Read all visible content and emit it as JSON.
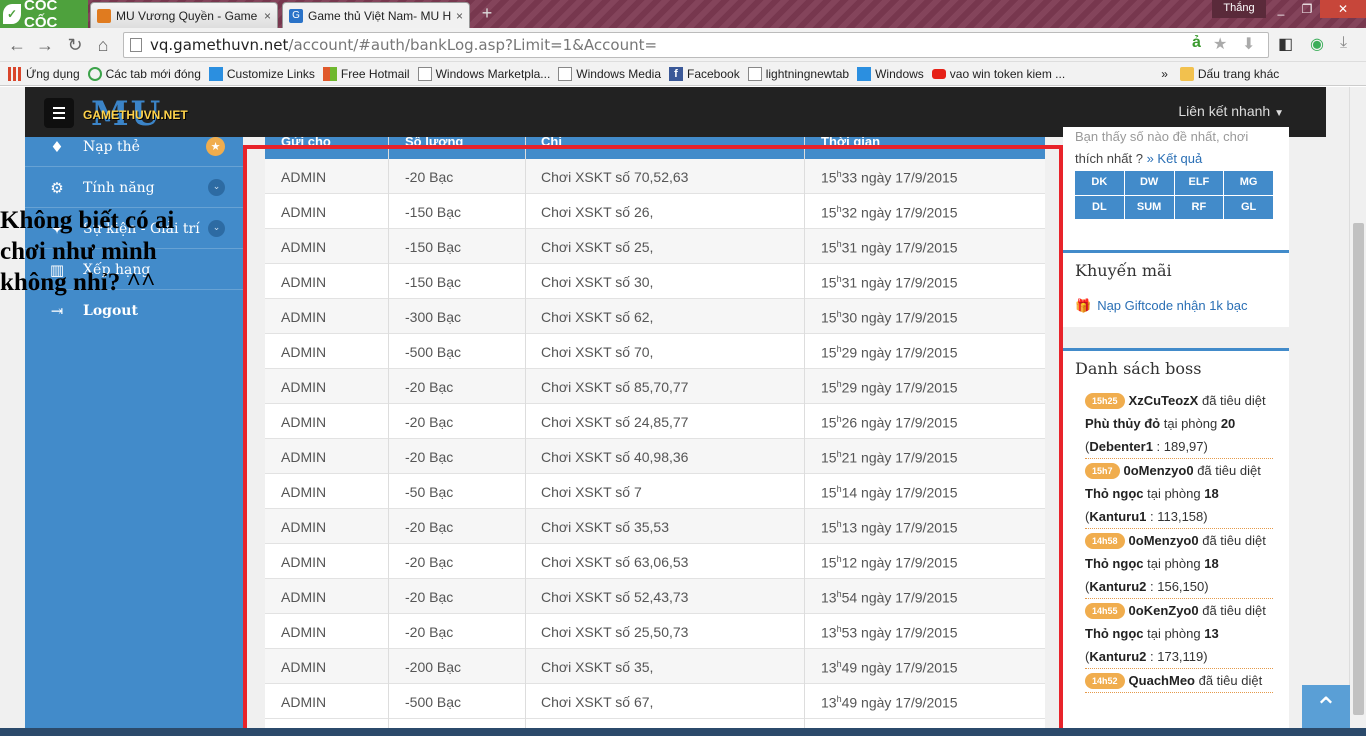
{
  "browser": {
    "brand": "CỐC CỐC",
    "tabs": [
      {
        "title": "MU Vương Quyền - Game",
        "close": "×"
      },
      {
        "title": "Game thủ Việt Nam- MU H",
        "close": "×"
      }
    ],
    "new_tab": "+",
    "user": "Thắng",
    "window_controls": [
      "_",
      "❐",
      "✕"
    ],
    "url_host": "vq.gamethuvn.net",
    "url_path": "/account/#auth/bankLog.asp?Limit=1&Account=",
    "bookmarks": [
      {
        "label": "Ứng dụng",
        "icon": "apps-grid-icon",
        "color": "#d9452b"
      },
      {
        "label": "Các tab mới đóng",
        "icon": "recent-tabs-icon",
        "color": "#3ca34a"
      },
      {
        "label": "Customize Links",
        "icon": "windows-logo-icon",
        "color": "#2b8fe0"
      },
      {
        "label": "Free Hotmail",
        "icon": "windows-flag-icon",
        "color": "#e0592b"
      },
      {
        "label": "Windows Marketpla...",
        "icon": "page-icon",
        "color": "#ffffff"
      },
      {
        "label": "Windows Media",
        "icon": "page-icon",
        "color": "#ffffff"
      },
      {
        "label": "Facebook",
        "icon": "facebook-icon",
        "color": "#3b5998"
      },
      {
        "label": "lightningnewtab",
        "icon": "page-icon",
        "color": "#ffffff"
      },
      {
        "label": "Windows",
        "icon": "windows-logo-icon",
        "color": "#2b8fe0"
      },
      {
        "label": "vao win token kiem ...",
        "icon": "youtube-icon",
        "color": "#e62117"
      }
    ],
    "bookmarks_overflow": "»",
    "other_bookmarks": "Dấu trang khác"
  },
  "site": {
    "logo_mu": "MU",
    "logo_text": "GAMETHUVN.NET",
    "quick_links": "Liên kết nhanh",
    "sidebar": [
      {
        "label": "Nạp thẻ",
        "icon": "diamond-icon",
        "glyph": "♦",
        "badge": "★"
      },
      {
        "label": "Tính năng",
        "icon": "gears-icon",
        "glyph": "⚙",
        "chev": "⌄"
      },
      {
        "label": "Sự kiện - Giải trí",
        "icon": "gamepad-icon",
        "glyph": "✦",
        "chev": "⌄"
      },
      {
        "label": "Xếp hạng",
        "icon": "bar-chart-icon",
        "glyph": "▥"
      },
      {
        "label": "Logout",
        "icon": "sign-out-icon",
        "glyph": "⇥"
      }
    ],
    "overlay_caption": "Không biết có ai chơi như mình không nhỉ? ^^"
  },
  "table": {
    "columns": [
      "Gửi cho",
      "Số lượng",
      "Chi",
      "Thời gian"
    ],
    "rows": [
      {
        "to": "ADMIN",
        "amount": "-20  Bạc",
        "desc": "Chơi XSKT số 70,52,63",
        "hour": "15",
        "minute": "33 ngày 17/9/2015"
      },
      {
        "to": "ADMIN",
        "amount": "-150  Bạc",
        "desc": "Chơi XSKT số 26,",
        "hour": "15",
        "minute": "32 ngày 17/9/2015"
      },
      {
        "to": "ADMIN",
        "amount": "-150  Bạc",
        "desc": "Chơi XSKT số 25,",
        "hour": "15",
        "minute": "31 ngày 17/9/2015"
      },
      {
        "to": "ADMIN",
        "amount": "-150  Bạc",
        "desc": "Chơi XSKT số 30,",
        "hour": "15",
        "minute": "31 ngày 17/9/2015"
      },
      {
        "to": "ADMIN",
        "amount": "-300  Bạc",
        "desc": "Chơi XSKT số 62,",
        "hour": "15",
        "minute": "30 ngày 17/9/2015"
      },
      {
        "to": "ADMIN",
        "amount": "-500  Bạc",
        "desc": "Chơi XSKT số 70,",
        "hour": "15",
        "minute": "29 ngày 17/9/2015"
      },
      {
        "to": "ADMIN",
        "amount": "-20  Bạc",
        "desc": "Chơi XSKT số 85,70,77",
        "hour": "15",
        "minute": "29 ngày 17/9/2015"
      },
      {
        "to": "ADMIN",
        "amount": "-20  Bạc",
        "desc": "Chơi XSKT số 24,85,77",
        "hour": "15",
        "minute": "26 ngày 17/9/2015"
      },
      {
        "to": "ADMIN",
        "amount": "-20  Bạc",
        "desc": "Chơi XSKT số 40,98,36",
        "hour": "15",
        "minute": "21 ngày 17/9/2015"
      },
      {
        "to": "ADMIN",
        "amount": "-50  Bạc",
        "desc": "Chơi XSKT số 7",
        "hour": "15",
        "minute": "14 ngày 17/9/2015"
      },
      {
        "to": "ADMIN",
        "amount": "-20  Bạc",
        "desc": "Chơi XSKT số 35,53",
        "hour": "15",
        "minute": "13 ngày 17/9/2015"
      },
      {
        "to": "ADMIN",
        "amount": "-20  Bạc",
        "desc": "Chơi XSKT số 63,06,53",
        "hour": "15",
        "minute": "12 ngày 17/9/2015"
      },
      {
        "to": "ADMIN",
        "amount": "-20  Bạc",
        "desc": "Chơi XSKT số 52,43,73",
        "hour": "13",
        "minute": "54 ngày 17/9/2015"
      },
      {
        "to": "ADMIN",
        "amount": "-20  Bạc",
        "desc": "Chơi XSKT số 25,50,73",
        "hour": "13",
        "minute": "53 ngày 17/9/2015"
      },
      {
        "to": "ADMIN",
        "amount": "-200  Bạc",
        "desc": "Chơi XSKT số 35,",
        "hour": "13",
        "minute": "49 ngày 17/9/2015"
      },
      {
        "to": "ADMIN",
        "amount": "-500  Bạc",
        "desc": "Chơi XSKT số 67,",
        "hour": "13",
        "minute": "49 ngày 17/9/2015"
      }
    ],
    "hour_suffix": "h"
  },
  "right": {
    "lottery_text_1": "Bạn thấy số nào đề nhất, chơi",
    "lottery_text_2": "thích nhất ?",
    "lottery_link": "» Kết quả",
    "lottery_buttons": [
      "DK",
      "DW",
      "ELF",
      "MG",
      "DL",
      "SUM",
      "RF",
      "GL"
    ],
    "promo_title": "Khuyến mãi",
    "promo_link": "Nạp Giftcode nhận 1k bạc",
    "boss_title": "Danh sách boss",
    "boss_entries": [
      {
        "time": "15h25",
        "killer": "XzCuTeozX",
        "verb": " đã tiêu diệt ",
        "boss": "Phù thủy đỏ",
        "at": " tại phòng ",
        "room": "20",
        "loc": "Debenter1",
        "coords": " : 189,97)"
      },
      {
        "time": "15h7",
        "killer": "0oMenzyo0",
        "verb": " đã tiêu diệt ",
        "boss": "Thỏ ngọc",
        "at": " tại phòng ",
        "room": "18",
        "loc": "Kanturu1",
        "coords": " : 113,158)"
      },
      {
        "time": "14h58",
        "killer": "0oMenzyo0",
        "verb": " đã tiêu diệt ",
        "boss": "Thỏ ngọc",
        "at": " tại phòng ",
        "room": "18",
        "loc": "Kanturu2",
        "coords": " : 156,150)"
      },
      {
        "time": "14h55",
        "killer": "0oKenZyo0",
        "verb": " đã tiêu diệt ",
        "boss": "Thỏ ngọc",
        "at": " tại phòng ",
        "room": "13",
        "loc": "Kanturu2",
        "coords": " : 173,119)"
      },
      {
        "time": "14h52",
        "killer": "QuachMeo",
        "verb": " đã tiêu diệt",
        "boss": "",
        "at": "",
        "room": "",
        "loc": "",
        "coords": ""
      }
    ],
    "scroll_top": "⌃"
  }
}
